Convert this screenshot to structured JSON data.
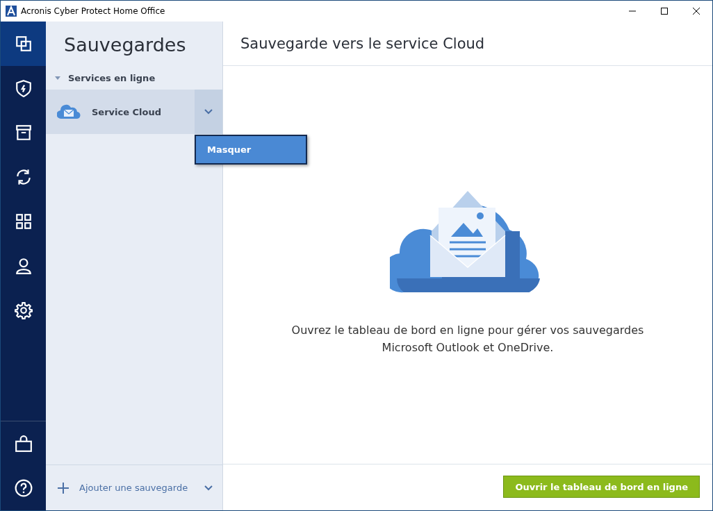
{
  "window": {
    "title": "Acronis Cyber Protect Home Office"
  },
  "nav": [
    {
      "kind": "backup",
      "selected": true
    },
    {
      "kind": "protection",
      "selected": false
    },
    {
      "kind": "archive",
      "selected": false
    },
    {
      "kind": "sync",
      "selected": false
    },
    {
      "kind": "tools",
      "selected": false
    },
    {
      "kind": "account",
      "selected": false
    },
    {
      "kind": "settings",
      "selected": false
    }
  ],
  "nav_bottom": [
    {
      "kind": "store",
      "selected": false
    },
    {
      "kind": "help",
      "selected": false
    }
  ],
  "sidebar": {
    "title": "Sauvegardes",
    "groups": [
      {
        "label": "Services en ligne",
        "expanded": true,
        "items": [
          {
            "label": "Service Cloud",
            "selected": true,
            "menu_open": true,
            "menu": [
              {
                "label": "Masquer",
                "selected": true
              }
            ]
          }
        ]
      }
    ],
    "add_button": "Ajouter une sauvegarde"
  },
  "main": {
    "title": "Sauvegarde vers le service Cloud",
    "description": "Ouvrez le tableau de bord en ligne pour gérer vos sauvegardes Microsoft Outlook et OneDrive.",
    "button": "Ouvrir le tableau de bord en ligne"
  }
}
